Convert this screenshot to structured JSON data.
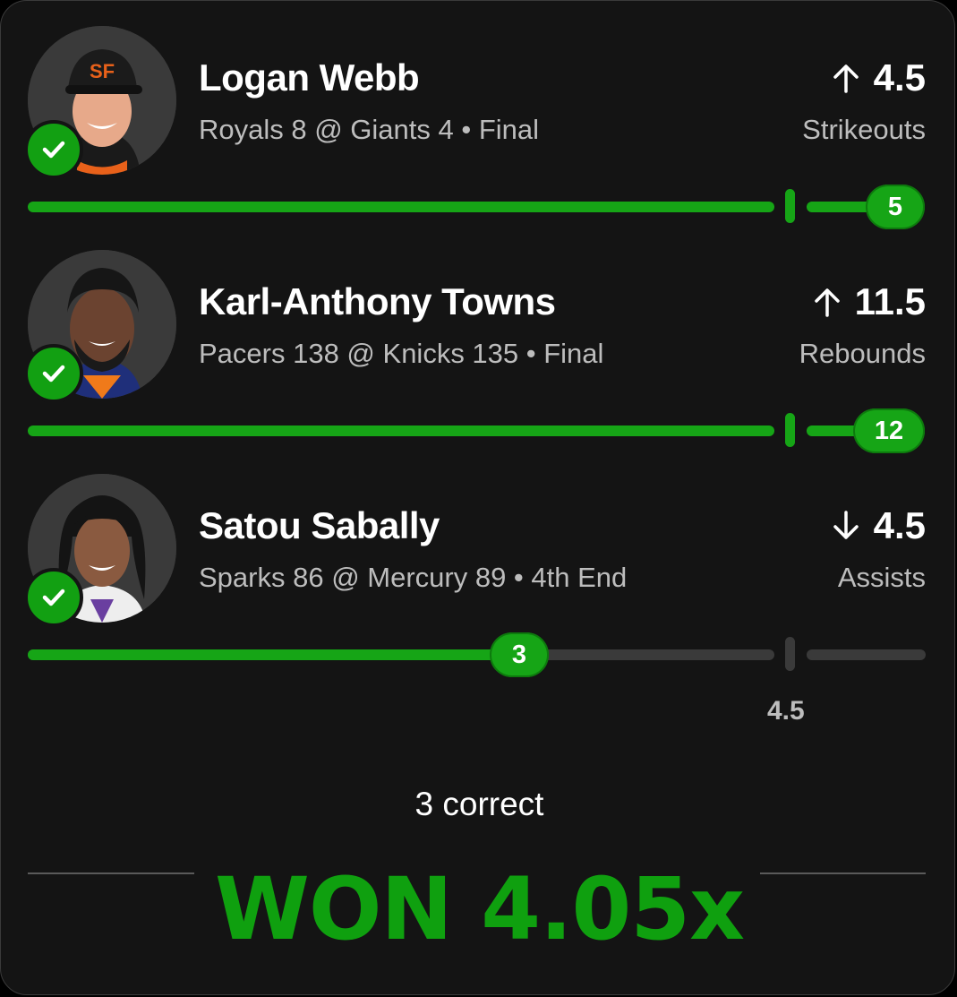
{
  "picks": [
    {
      "name": "Logan Webb",
      "game": "Royals 8 @ Giants 4 • Final",
      "direction": "up",
      "arrow": "↑",
      "line": "4.5",
      "stat": "Strikeouts",
      "result": "5",
      "progress": 1.0,
      "correct": true
    },
    {
      "name": "Karl-Anthony Towns",
      "game": "Pacers 138 @ Knicks 135 • Final",
      "direction": "up",
      "arrow": "↑",
      "line": "11.5",
      "stat": "Rebounds",
      "result": "12",
      "progress": 1.0,
      "correct": true
    },
    {
      "name": "Satou Sabally",
      "game": "Sparks 86 @ Mercury 89 • 4th End",
      "direction": "down",
      "arrow": "↓",
      "line": "4.5",
      "stat": "Assists",
      "result": "3",
      "progress": 0.55,
      "correct": true,
      "line_label": "4.5"
    }
  ],
  "summary": {
    "correct_text": "3 correct",
    "won_text": "WON 4.05x"
  },
  "colors": {
    "accent": "#16a516",
    "background": "#141414",
    "muted_text": "#bdbdbd",
    "track": "#3a3a3a"
  },
  "icons": {
    "check": "check-circle-icon",
    "up": "arrow-up-icon",
    "down": "arrow-down-icon"
  }
}
